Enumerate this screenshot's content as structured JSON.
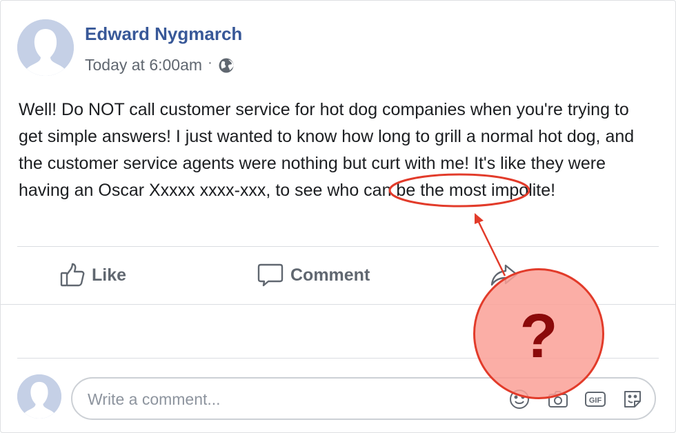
{
  "post": {
    "author": "Edward Nygmarch",
    "timestamp": "Today at 6:00am",
    "separator": "·",
    "privacy_icon": "globe-icon",
    "text": "Well! Do NOT call customer service for hot dog companies when you're trying to get simple answers! I just wanted to know how long to grill a normal hot dog, and the customer service agents were nothing but curt with me! It's like they were having an Oscar Xxxxx xxxx-xxx, to see who can be the most impolite!"
  },
  "actions": {
    "like": {
      "label": "Like",
      "icon": "thumbs-up-icon"
    },
    "comment": {
      "label": "Comment",
      "icon": "comment-bubble-icon"
    },
    "share": {
      "icon": "share-arrow-icon"
    }
  },
  "comment_box": {
    "placeholder": "Write a comment...",
    "icons": [
      "emoji-icon",
      "camera-icon",
      "gif-icon",
      "sticker-icon"
    ],
    "gif_label": "GIF"
  },
  "annotation": {
    "question_mark": "?",
    "highlight_color": "#e23b2a",
    "circle_fill": "#faa096"
  },
  "colors": {
    "author_link": "#385898",
    "meta_text": "#606770",
    "action_text": "#606770",
    "divider": "#dadde1"
  }
}
